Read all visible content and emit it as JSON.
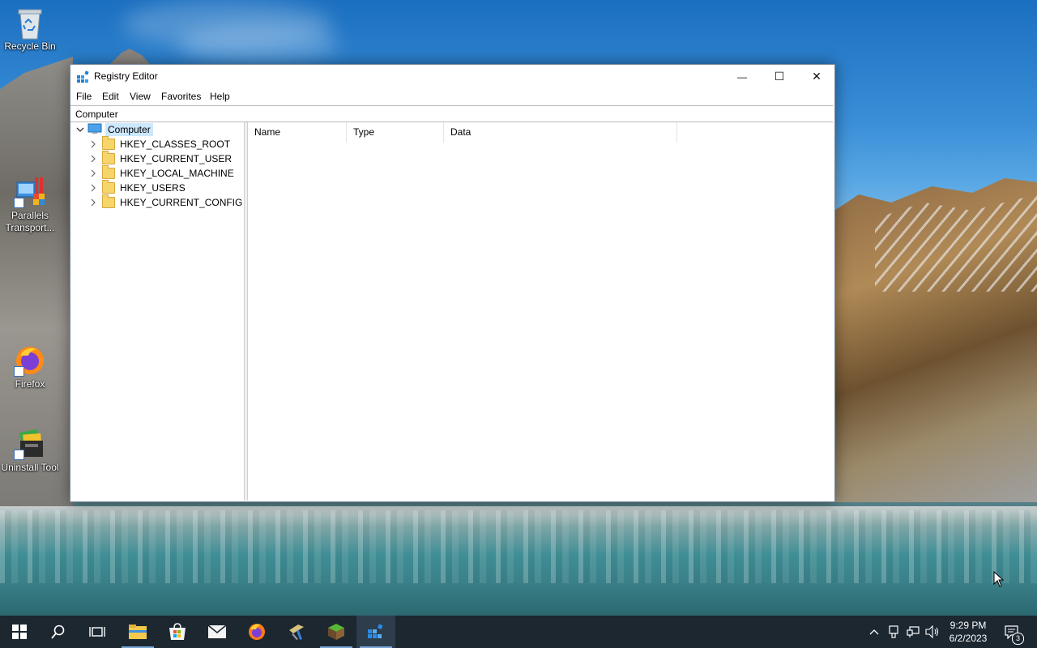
{
  "desktop": {
    "icons": [
      {
        "label": "Recycle Bin",
        "icon": "recycle-bin-icon"
      },
      {
        "label": "Parallels Transport...",
        "icon": "parallels-transporter-icon"
      },
      {
        "label": "Firefox",
        "icon": "firefox-icon"
      },
      {
        "label": "Uninstall Tool",
        "icon": "uninstall-tool-icon"
      }
    ]
  },
  "window": {
    "title": "Registry Editor",
    "controls": {
      "minimize": "—",
      "maximize": "☐",
      "close": "✕"
    },
    "menu": [
      "File",
      "Edit",
      "View",
      "Favorites",
      "Help"
    ],
    "address": "Computer",
    "tree": {
      "root": "Computer",
      "root_expanded": true,
      "children": [
        "HKEY_CLASSES_ROOT",
        "HKEY_CURRENT_USER",
        "HKEY_LOCAL_MACHINE",
        "HKEY_USERS",
        "HKEY_CURRENT_CONFIG"
      ]
    },
    "list": {
      "columns": [
        "Name",
        "Type",
        "Data"
      ],
      "rows": []
    }
  },
  "taskbar": {
    "items": [
      "start-button",
      "search-button",
      "task-view-button",
      "file-explorer",
      "microsoft-store",
      "mail",
      "firefox",
      "parallels-tool",
      "minecraft",
      "registry-editor"
    ],
    "active": "registry-editor",
    "clock": {
      "time": "9:29 PM",
      "date": "6/2/2023"
    },
    "notification_count": "3"
  },
  "colors": {
    "selection": "#cce8ff",
    "taskbar": "#1c2730",
    "accent": "#7aa6d6"
  }
}
